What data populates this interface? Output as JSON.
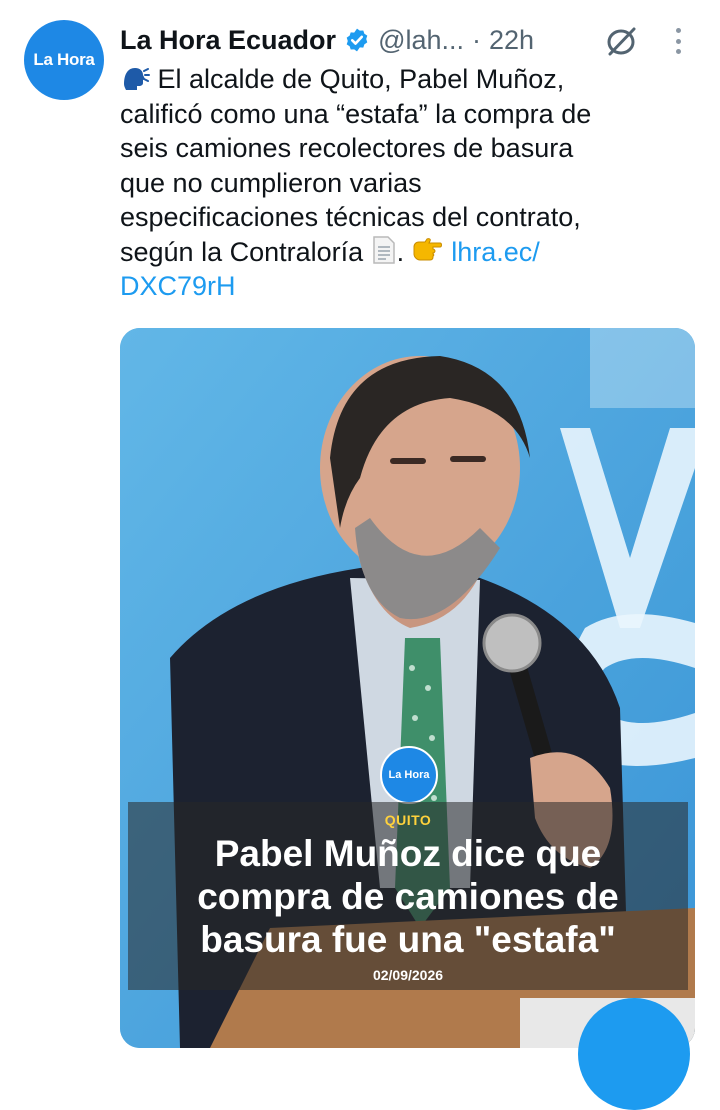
{
  "tweet": {
    "avatar_text": "La Hora",
    "display_name": "La Hora Ecuador",
    "handle": "@lah...",
    "separator": "·",
    "time": "22h",
    "text_lines": [
      "El alcalde de Quito, Pabel Muñoz,",
      "calificó como una “estafa” la compra de",
      "seis camiones recolectores de basura",
      "que no cumplieron varias",
      "especificaciones técnicas del contrato,",
      "según la Contraloría"
    ],
    "link_part1": "lhra.ec/",
    "link_part2": "DXC79rH"
  },
  "card": {
    "logo_text": "La Hora",
    "section": "QUITO",
    "headline_lines": [
      "Pabel Muñoz dice que",
      "compra de camiones de",
      "basura fue una \"estafa\""
    ],
    "date": "02/09/2026"
  },
  "colors": {
    "avatar_bg": "#1e88e5",
    "link": "#1d9bf0",
    "verified": "#1d9bf0",
    "section_label": "#ffd23c"
  },
  "icons": [
    "speaking-head-icon",
    "verified-badge-icon",
    "mute-icon",
    "more-icon",
    "page-facing-up-icon",
    "pointing-right-icon"
  ]
}
